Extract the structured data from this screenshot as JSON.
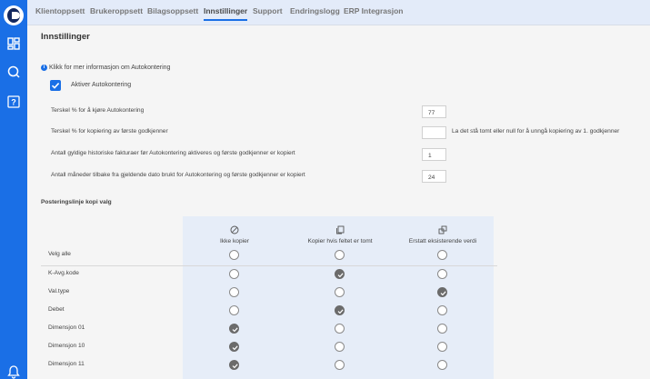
{
  "nav": {
    "tabs": [
      {
        "label": "Klientoppsett"
      },
      {
        "label": "Brukeroppsett"
      },
      {
        "label": "Bilagsoppsett"
      },
      {
        "label": "Innstillinger",
        "active": true
      },
      {
        "label": "Support"
      },
      {
        "label": "Endringslogg"
      },
      {
        "label": "ERP Integrasjon"
      }
    ]
  },
  "sidebar": {
    "icons": [
      "dashboard-icon",
      "search-icon",
      "help-icon",
      "bell-icon"
    ]
  },
  "page": {
    "title": "Innstillinger",
    "info_icon": "i",
    "info_text": "Klikk for mer informasjon om Autokontering",
    "activate_label": "Aktiver Autokontering",
    "activate_checked": true
  },
  "settings": [
    {
      "label": "Terskel % for å kjøre Autokontering",
      "value": "77",
      "hint": ""
    },
    {
      "label": "Terskel % for kopiering av første godkjenner",
      "value": "",
      "hint": "La det stå tomt eller null for å unngå kopiering av 1. godkjenner"
    },
    {
      "label": "Antall gyldige historiske fakturaer før Autokontering aktiveres og første godkjenner er kopiert",
      "value": "1",
      "hint": ""
    },
    {
      "label": "Antall måneder tilbake fra gjeldende dato brukt for Autokontering og første godkjenner er kopiert",
      "value": "24",
      "hint": ""
    }
  ],
  "copy_options": {
    "section_title": "Posteringslinje kopi valg",
    "columns": [
      {
        "label": "Ikke kopier",
        "icon": "no-copy-icon"
      },
      {
        "label": "Kopier hvis feltet er tomt",
        "icon": "copy-if-empty-icon"
      },
      {
        "label": "Erstatt eksisterende verdi",
        "icon": "replace-value-icon"
      }
    ],
    "select_all_label": "Velg alle",
    "rows": [
      {
        "label": "K-Avg.kode",
        "selected": 1
      },
      {
        "label": "Val.type",
        "selected": 2
      },
      {
        "label": "Debet",
        "selected": 1
      },
      {
        "label": "Dimensjon 01",
        "selected": 0
      },
      {
        "label": "Dimensjon 10",
        "selected": 0
      },
      {
        "label": "Dimensjon 11",
        "selected": 0
      }
    ]
  },
  "colors": {
    "accent": "#1a6fe6",
    "nav_bg": "#e3ebf9",
    "column_highlight": "#e6edf8",
    "radio_selected": "#6b6b6b"
  }
}
